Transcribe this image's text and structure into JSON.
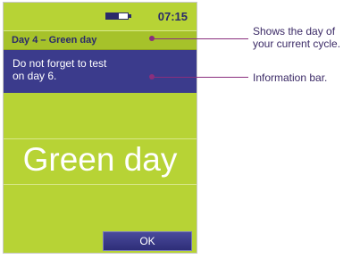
{
  "status": {
    "time": "07:15",
    "battery_level": 0.6
  },
  "header": {
    "day_label": "Day 4 – Green day"
  },
  "info": {
    "message": "Do not forget to test\non day 6."
  },
  "main": {
    "day_status": "Green day"
  },
  "actions": {
    "ok_label": "OK"
  },
  "annotations": {
    "day_callout": "Shows the day of\nyour current cycle.",
    "info_callout": "Information bar."
  },
  "colors": {
    "screen_background": "#b7d335",
    "info_bar": "#3b3b8c",
    "text_dark": "#2a2a6a",
    "callout": "#8a2f7d"
  }
}
